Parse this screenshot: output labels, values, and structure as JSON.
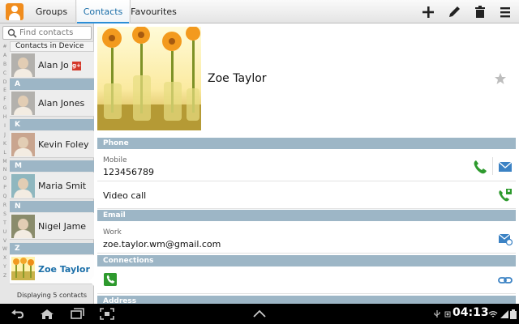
{
  "tabs": [
    {
      "label": "Groups"
    },
    {
      "label": "Contacts"
    },
    {
      "label": "Favourites"
    }
  ],
  "sidebar": {
    "search_placeholder": "Find contacts",
    "section_label": "Contacts in Device",
    "index_letters": [
      "#",
      "A",
      "B",
      "C",
      "D",
      "E",
      "F",
      "G",
      "H",
      "I",
      "J",
      "K",
      "L",
      "M",
      "N",
      "O",
      "P",
      "Q",
      "R",
      "S",
      "T",
      "U",
      "V",
      "W",
      "X",
      "Y",
      "Z"
    ],
    "letters": [
      "A",
      "K",
      "M",
      "N",
      "Z"
    ],
    "contacts": [
      {
        "name": "Alan Jo"
      },
      {
        "name": "Alan Jones"
      },
      {
        "name": "Kevin Foley"
      },
      {
        "name": "Maria Smit"
      },
      {
        "name": "Nigel Jame"
      },
      {
        "name": "Zoe Taylor"
      }
    ],
    "footer": "Displaying 5 contacts"
  },
  "detail": {
    "name": "Zoe Taylor",
    "sections": {
      "phone": "Phone",
      "email": "Email",
      "connections": "Connections",
      "address": "Address"
    },
    "mobile_label": "Mobile",
    "mobile_value": "123456789",
    "video_call": "Video call",
    "work_label": "Work",
    "email_value": "zoe.taylor.wm@gmail.com"
  },
  "status": {
    "time": "04:13"
  },
  "colors": {
    "accent": "#2c8ed6",
    "section_header": "#9db6c6",
    "call_green": "#2e9a2e",
    "app_icon": "#f08c1d"
  }
}
